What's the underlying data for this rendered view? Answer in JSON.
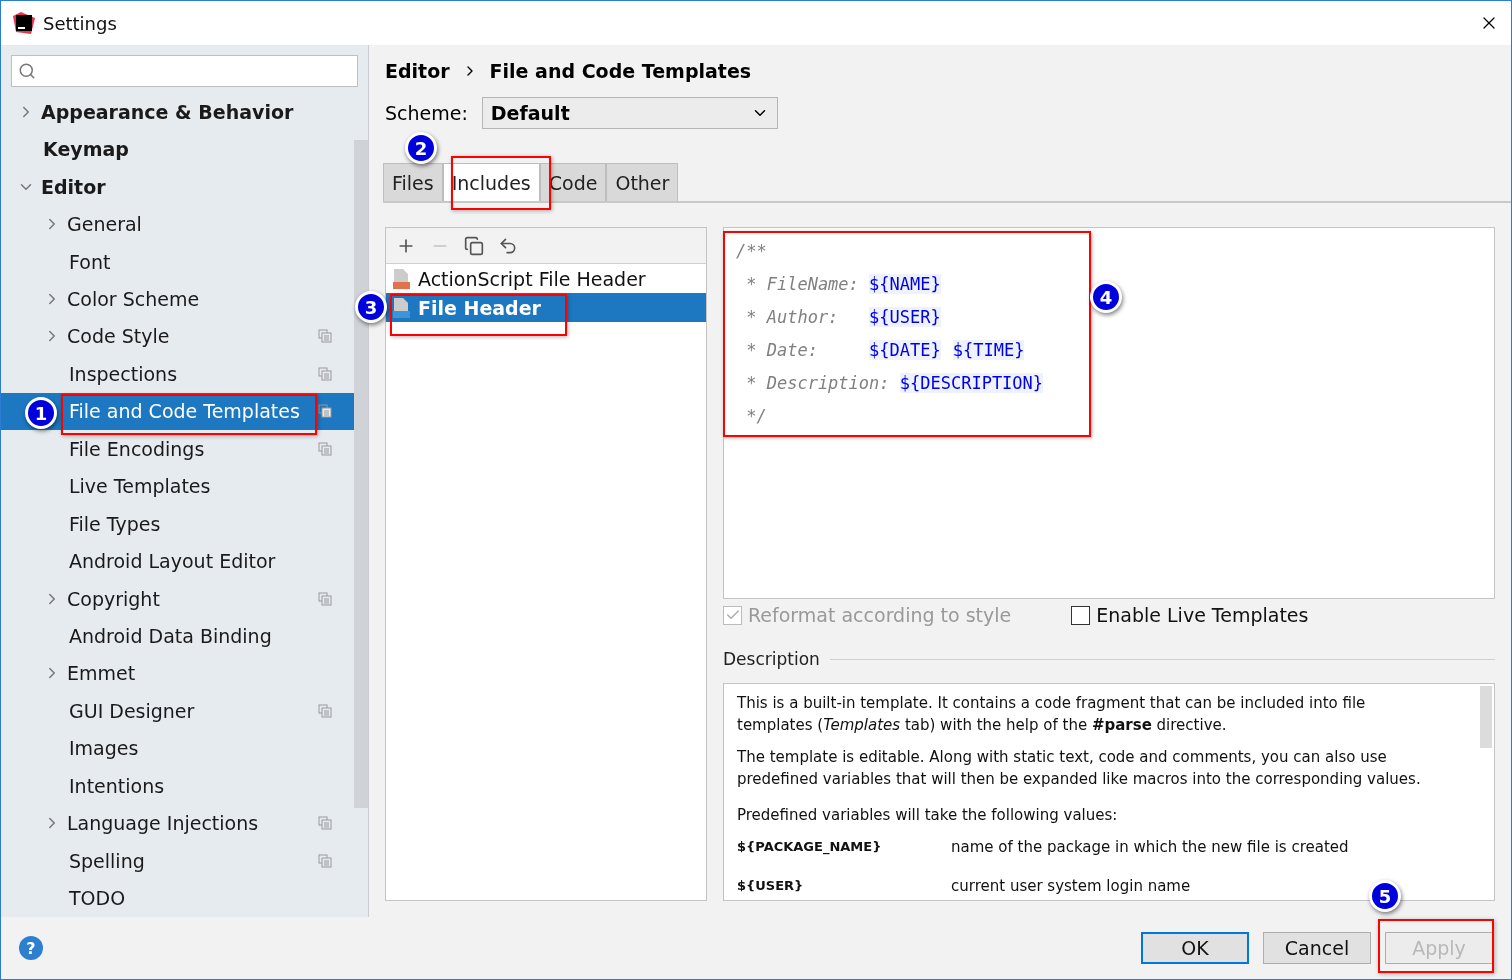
{
  "window": {
    "title": "Settings"
  },
  "sidebar": {
    "items": [
      {
        "label": "Appearance & Behavior",
        "bold": true,
        "expanded": false,
        "selected": false,
        "project_icon": false
      },
      {
        "label": "Keymap",
        "bold": true,
        "selected": false,
        "project_icon": false
      },
      {
        "label": "Editor",
        "bold": true,
        "expanded": true,
        "selected": false,
        "project_icon": false,
        "children": [
          {
            "label": "General",
            "expanded": false,
            "selected": false,
            "project_icon": false
          },
          {
            "label": "Font",
            "selected": false,
            "project_icon": false
          },
          {
            "label": "Color Scheme",
            "expanded": false,
            "selected": false,
            "project_icon": false
          },
          {
            "label": "Code Style",
            "expanded": false,
            "selected": false,
            "project_icon": true
          },
          {
            "label": "Inspections",
            "selected": false,
            "project_icon": true
          },
          {
            "label": "File and Code Templates",
            "selected": true,
            "project_icon": true
          },
          {
            "label": "File Encodings",
            "selected": false,
            "project_icon": true
          },
          {
            "label": "Live Templates",
            "selected": false,
            "project_icon": false
          },
          {
            "label": "File Types",
            "selected": false,
            "project_icon": false
          },
          {
            "label": "Android Layout Editor",
            "selected": false,
            "project_icon": false
          },
          {
            "label": "Copyright",
            "expanded": false,
            "selected": false,
            "project_icon": true
          },
          {
            "label": "Android Data Binding",
            "selected": false,
            "project_icon": false
          },
          {
            "label": "Emmet",
            "expanded": false,
            "selected": false,
            "project_icon": false
          },
          {
            "label": "GUI Designer",
            "selected": false,
            "project_icon": true
          },
          {
            "label": "Images",
            "selected": false,
            "project_icon": false
          },
          {
            "label": "Intentions",
            "selected": false,
            "project_icon": false
          },
          {
            "label": "Language Injections",
            "expanded": false,
            "selected": false,
            "project_icon": true
          },
          {
            "label": "Spelling",
            "selected": false,
            "project_icon": true
          },
          {
            "label": "TODO",
            "selected": false,
            "project_icon": false
          }
        ]
      }
    ]
  },
  "breadcrumb": [
    "Editor",
    "File and Code Templates"
  ],
  "scheme": {
    "label": "Scheme:",
    "value": "Default"
  },
  "tabs": [
    {
      "label": "Files",
      "selected": false
    },
    {
      "label": "Includes",
      "selected": true
    },
    {
      "label": "Code",
      "selected": false
    },
    {
      "label": "Other",
      "selected": false
    }
  ],
  "toolbar": [
    {
      "kind": "add",
      "disabled": false
    },
    {
      "kind": "remove",
      "disabled": true
    },
    {
      "kind": "copy",
      "disabled": false
    },
    {
      "kind": "reset",
      "disabled": false
    }
  ],
  "templates": [
    {
      "label": "ActionScript File Header",
      "kind": "as",
      "selected": false
    },
    {
      "label": "File Header",
      "kind": "java",
      "selected": true
    }
  ],
  "code_lines": [
    [
      {
        "kind": "comment",
        "text": "/**"
      }
    ],
    [
      {
        "kind": "comment",
        "text": " * FileName: "
      },
      {
        "kind": "variable",
        "text": "${NAME}"
      }
    ],
    [
      {
        "kind": "comment",
        "text": " * Author:   "
      },
      {
        "kind": "variable",
        "text": "${USER}"
      }
    ],
    [
      {
        "kind": "comment",
        "text": " * Date:     "
      },
      {
        "kind": "variable",
        "text": "${DATE}"
      },
      {
        "kind": "variable",
        "text": "${TIME}"
      }
    ],
    [
      {
        "kind": "comment",
        "text": " * Description: "
      },
      {
        "kind": "variable",
        "text": "${DESCRIPTION}"
      }
    ],
    [
      {
        "kind": "comment",
        "text": " */"
      }
    ]
  ],
  "options": [
    {
      "label": "Reformat according to style",
      "checked": true,
      "disabled": true
    },
    {
      "label": "Enable Live Templates",
      "checked": false,
      "disabled": false
    }
  ],
  "description": {
    "title": "Description",
    "paragraphs": [
      "This is a built-in template. It contains a code fragment that can be included into file templates (*Templates* tab) with the help of the **#parse** directive.",
      "The template is editable. Along with static text, code and comments, you can also use predefined variables that will then be expanded like macros into the corresponding values.",
      "Predefined variables will take the following values:"
    ],
    "variables": [
      {
        "name": "${PACKAGE_NAME}",
        "meaning": "name of the package in which the new file is created"
      },
      {
        "name": "${USER}",
        "meaning": "current user system login name"
      }
    ]
  },
  "help": "?",
  "buttons": [
    {
      "label": "OK",
      "default": true,
      "disabled": false
    },
    {
      "label": "Cancel",
      "default": false,
      "disabled": false
    },
    {
      "label": "Apply",
      "default": false,
      "disabled": true
    }
  ],
  "callouts": [
    {
      "number": "1"
    },
    {
      "number": "2"
    },
    {
      "number": "3"
    },
    {
      "number": "4"
    },
    {
      "number": "5"
    }
  ]
}
